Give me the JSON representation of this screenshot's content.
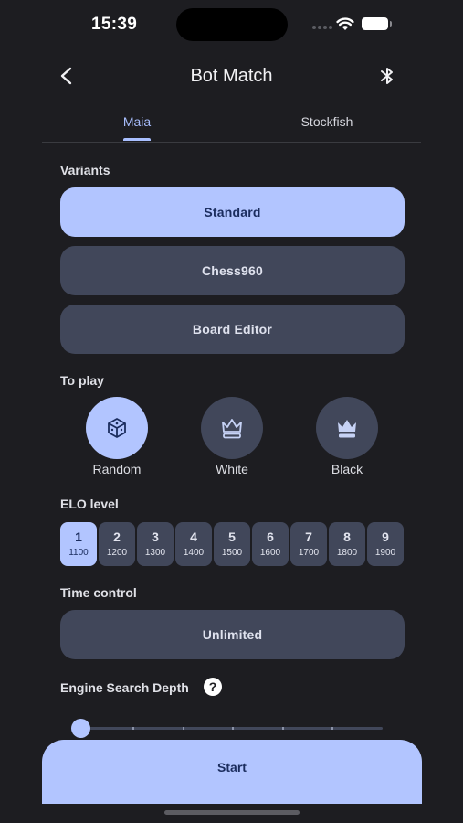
{
  "status_bar": {
    "time": "15:39"
  },
  "header": {
    "title": "Bot Match",
    "back_icon": "chevron-left-icon",
    "action_icon": "bluetooth-icon"
  },
  "tabs": [
    {
      "label": "Maia",
      "selected": true
    },
    {
      "label": "Stockfish",
      "selected": false
    }
  ],
  "variants": {
    "label": "Variants",
    "options": [
      {
        "label": "Standard",
        "selected": true
      },
      {
        "label": "Chess960",
        "selected": false
      },
      {
        "label": "Board Editor",
        "selected": false
      }
    ]
  },
  "to_play": {
    "label": "To play",
    "options": [
      {
        "label": "Random",
        "icon": "dice-icon",
        "selected": true
      },
      {
        "label": "White",
        "icon": "white-king-icon",
        "selected": false
      },
      {
        "label": "Black",
        "icon": "black-king-icon",
        "selected": false
      }
    ]
  },
  "elo": {
    "label": "ELO level",
    "selected_level": "1",
    "levels": [
      {
        "level": "1",
        "rating": "1100"
      },
      {
        "level": "2",
        "rating": "1200"
      },
      {
        "level": "3",
        "rating": "1300"
      },
      {
        "level": "4",
        "rating": "1400"
      },
      {
        "level": "5",
        "rating": "1500"
      },
      {
        "level": "6",
        "rating": "1600"
      },
      {
        "level": "7",
        "rating": "1700"
      },
      {
        "level": "8",
        "rating": "1800"
      },
      {
        "level": "9",
        "rating": "1900"
      }
    ]
  },
  "time_control": {
    "label": "Time control",
    "value": "Unlimited"
  },
  "search_depth": {
    "label": "Engine Search Depth",
    "help_icon": "help-icon",
    "help_glyph": "?",
    "slider_fraction": 0
  },
  "start": {
    "label": "Start"
  },
  "colors": {
    "background": "#1d1d21",
    "accent": "#b2c5ff",
    "surface": "#41475a",
    "on_accent": "#1b2d5e"
  }
}
